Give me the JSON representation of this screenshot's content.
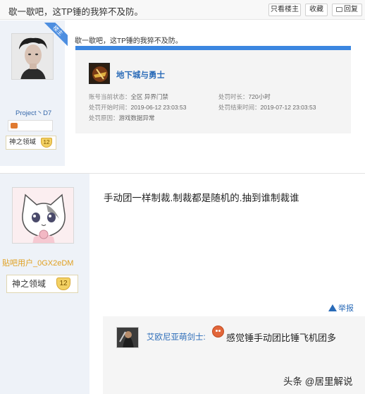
{
  "topbar": {
    "title": "歇一歇吧，这TP锤的我猝不及防。",
    "buttons": {
      "only_op": "只看楼主",
      "favorite": "收藏",
      "reply": "回复"
    }
  },
  "post1": {
    "badge": "楼主",
    "username": "Project丶D7",
    "level_name": "神之领域",
    "level": "12",
    "content": "歇一歇吧，这TP锤的我猝不及防。",
    "ban_card": {
      "game_name": "地下城与勇士",
      "status_label": "账号当前状态：",
      "status_value": "全区 异界门禁",
      "duration_label": "处罚时长：",
      "duration_value": "720小时",
      "start_label": "处罚开始时间：",
      "start_value": "2019-06-12 23:03:53",
      "end_label": "处罚结束时间：",
      "end_value": "2019-07-12 23:03:53",
      "reason_label": "处罚原因：",
      "reason_value": "游戏数据异常"
    }
  },
  "post2": {
    "username": "贴吧用户_0GX2eDM",
    "level_name": "神之领域",
    "level": "12",
    "content": "手动团一样制裁.制裁都是随机的.抽到谁制裁谁",
    "report": "举报",
    "reply": {
      "username": "艾欧尼亚萌剑士:",
      "text": "感觉锤手动团比锤飞机团多"
    }
  },
  "watermark": "头条 @居里解说",
  "icons": {
    "only_op": "person-icon",
    "favorite": "star-icon",
    "reply": "comment-icon",
    "report": "warning-icon",
    "emoji": "face-emoji-icon"
  }
}
